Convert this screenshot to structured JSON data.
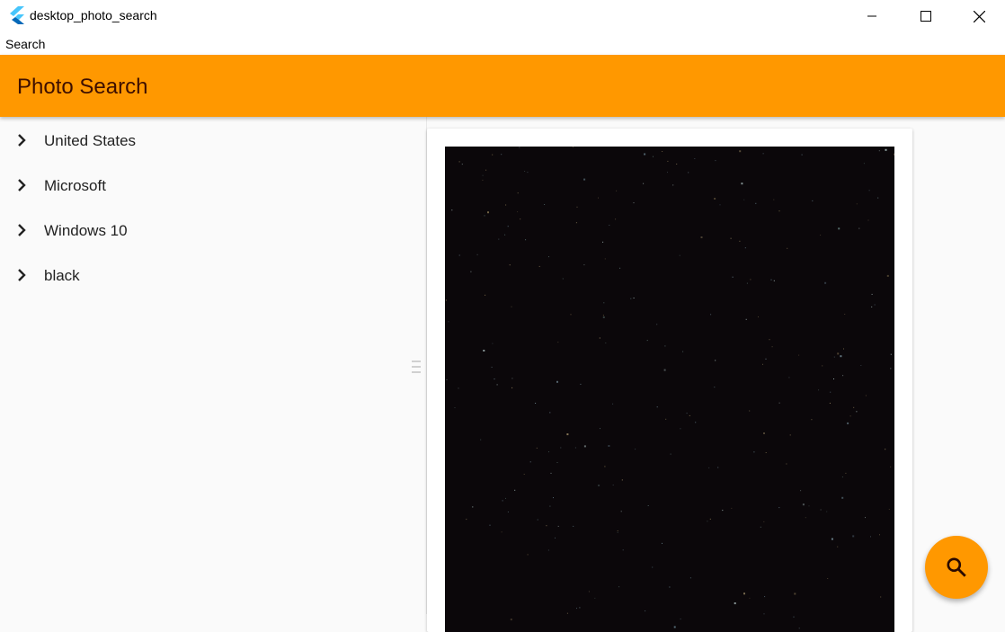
{
  "window": {
    "title": "desktop_photo_search",
    "icons": {
      "app": "flutter-logo-icon",
      "minimize": "minimize-icon",
      "maximize": "maximize-icon",
      "close": "close-icon"
    }
  },
  "menubar": {
    "items": [
      {
        "label": "Search"
      }
    ]
  },
  "appbar": {
    "title": "Photo Search",
    "color": "#ff9800",
    "title_color": "#3e0f00"
  },
  "tree": {
    "items": [
      {
        "label": "United States",
        "icon": "chevron-right-icon"
      },
      {
        "label": "Microsoft",
        "icon": "chevron-right-icon"
      },
      {
        "label": "Windows 10",
        "icon": "chevron-right-icon"
      },
      {
        "label": "black",
        "icon": "chevron-right-icon"
      }
    ]
  },
  "photo": {
    "description": "dark starry night sky photo",
    "background": "#0b070a"
  },
  "fab": {
    "icon": "search-icon",
    "color": "#ff9800"
  }
}
